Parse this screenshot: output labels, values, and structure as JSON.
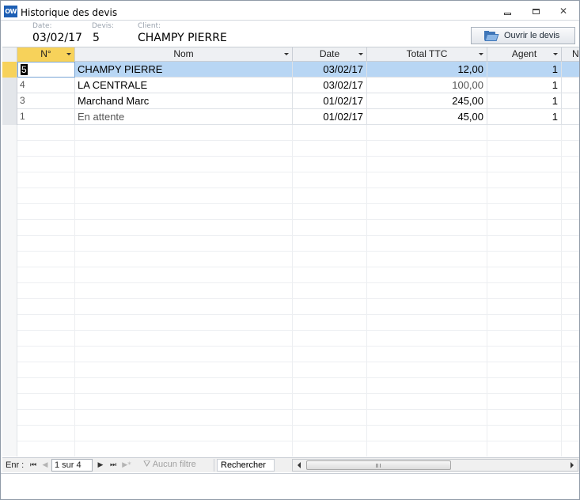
{
  "window": {
    "app_icon_text": "OW",
    "title": "Historique des devis",
    "controls": [
      "minimize-icon",
      "maximize-icon",
      "close-icon"
    ]
  },
  "header": {
    "date_label": "Date:",
    "date_value": "03/02/17",
    "devis_label": "Devis:",
    "devis_value": "5",
    "client_label": "Client:",
    "client_value": "CHAMPY PIERRE",
    "open_button_label": "Ouvrir le devis",
    "open_button_icon": "folder-open-icon"
  },
  "grid": {
    "columns": [
      {
        "key": "num",
        "label": "N°"
      },
      {
        "key": "nom",
        "label": "Nom"
      },
      {
        "key": "date",
        "label": "Date"
      },
      {
        "key": "total",
        "label": "Total TTC"
      },
      {
        "key": "agent",
        "label": "Agent"
      },
      {
        "key": "more",
        "label": "N"
      }
    ],
    "rows": [
      {
        "num": "5",
        "nom": "CHAMPY PIERRE",
        "date": "03/02/17",
        "total": "12,00",
        "agent": "1",
        "selected": true
      },
      {
        "num": "4",
        "nom": "LA CENTRALE",
        "date": "03/02/17",
        "total": "100,00",
        "agent": "1",
        "selected": false
      },
      {
        "num": "3",
        "nom": "Marchand Marc",
        "date": "01/02/17",
        "total": "245,00",
        "agent": "1",
        "selected": false
      },
      {
        "num": "1",
        "nom": "En attente",
        "date": "01/02/17",
        "total": "45,00",
        "agent": "1",
        "selected": false
      }
    ]
  },
  "navigation": {
    "label": "Enr :",
    "page": "1 sur 4",
    "filter": "Aucun filtre",
    "search": "Rechercher"
  },
  "colors": {
    "selected_row": "#b8d6f4",
    "active_header": "#f7d25a",
    "grid_line": "#dde1e6"
  }
}
